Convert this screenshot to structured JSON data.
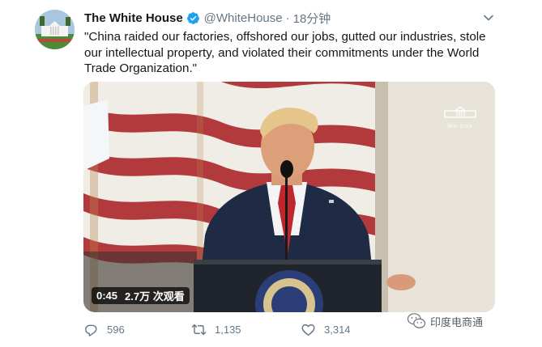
{
  "author": {
    "display_name": "The White House",
    "handle": "@WhiteHouse",
    "separator": "·",
    "time": "18分钟",
    "verified_icon": "verified-badge-icon",
    "avatar_icon": "white-house-avatar"
  },
  "tweet": {
    "text": "\"China raided our factories, offshored our jobs, gutted our industries, stole our intellectual property, and violated their commitments under the World Trade Organization.\""
  },
  "media": {
    "type": "video",
    "duration": "0:45",
    "views": "2.7万 次观看",
    "logo_text": "WH.GOV"
  },
  "actions": {
    "reply_count": "596",
    "retweet_count": "1,135",
    "like_count": "3,314"
  },
  "watermark": {
    "text": "印度电商通"
  },
  "colors": {
    "text_primary": "#14171a",
    "text_secondary": "#657786",
    "verified_blue": "#1da1f2"
  }
}
